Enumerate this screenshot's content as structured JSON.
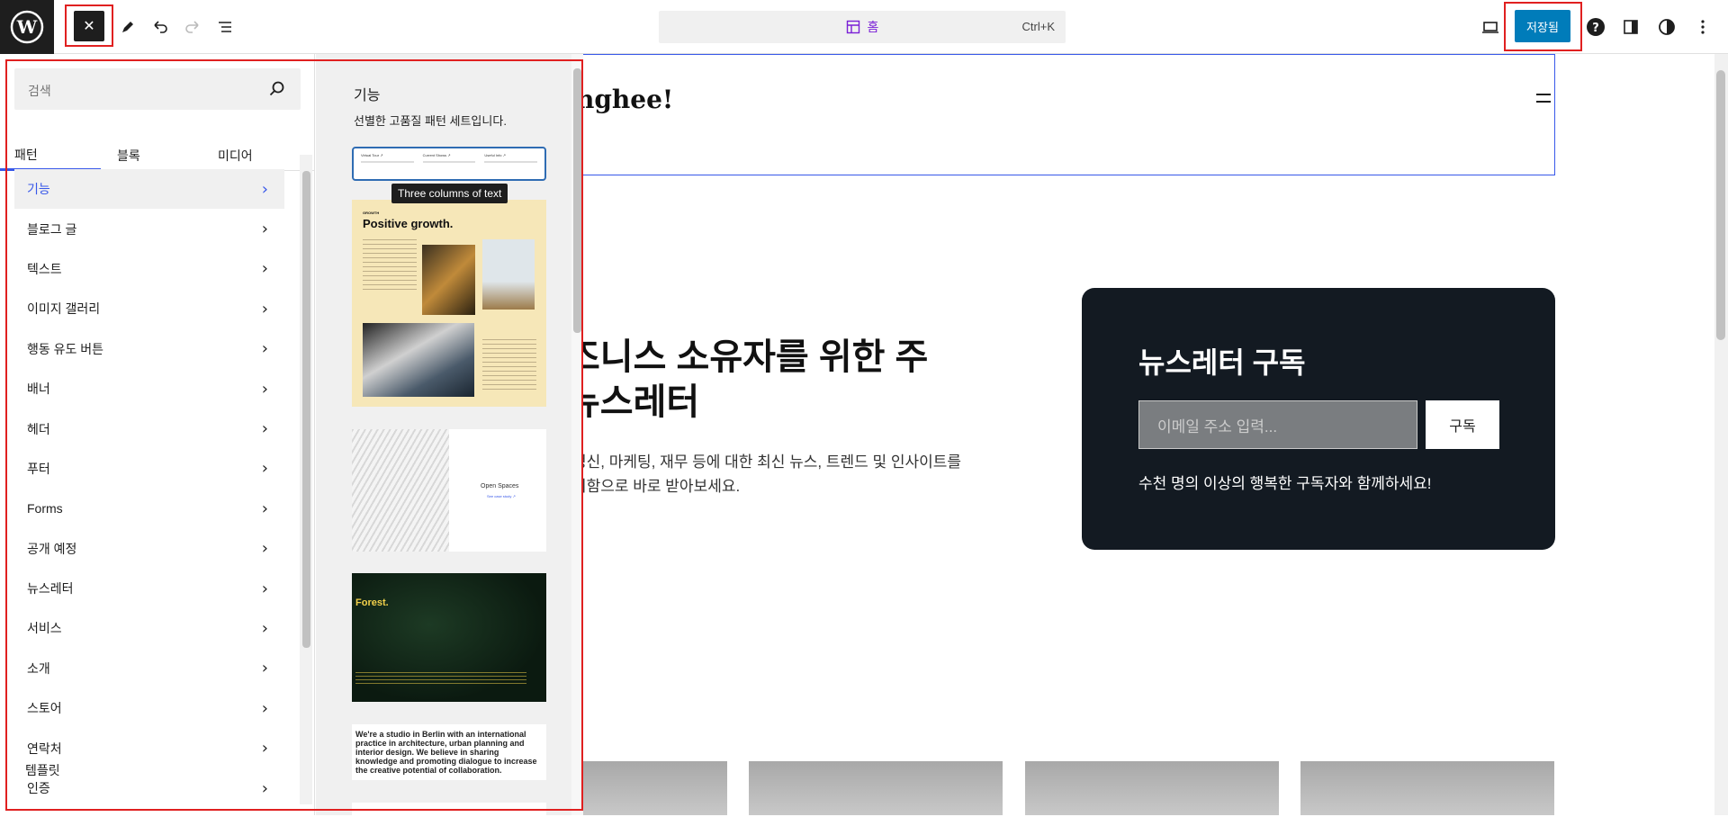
{
  "toolbar": {
    "close_label": "✕",
    "document_title": "홈",
    "shortcut": "Ctrl+K",
    "save_label": "저장됨"
  },
  "site": {
    "title_partial": "nghee!"
  },
  "hero": {
    "heading": "즈니스 소유자를 위한 주\n뉴스레터",
    "text": "정신, 마케팅, 재무 등에 대한 최신 뉴스, 트렌드 및 인사이트를\n지함으로 바로 받아보세요."
  },
  "newsletter": {
    "title": "뉴스레터 구독",
    "placeholder": "이메일 주소 입력...",
    "button": "구독",
    "footnote": "수천 명의 이상의 행복한 구독자와 함께하세요!"
  },
  "inserter": {
    "search_placeholder": "검색",
    "tabs": [
      "패턴",
      "블록",
      "미디어"
    ],
    "categories": [
      "기능",
      "블로그 글",
      "텍스트",
      "이미지 갤러리",
      "행동 유도 버튼",
      "배너",
      "헤더",
      "푸터",
      "Forms",
      "공개 예정",
      "뉴스레터",
      "서비스",
      "소개",
      "스토어",
      "연락처",
      "인증"
    ],
    "templates_label": "템플릿"
  },
  "patterns": {
    "category_title": "기능",
    "category_desc": "선별한 고품질 패턴 세트입니다.",
    "tooltip": "Three columns of text",
    "three_cols": [
      "Virtual Tour ↗",
      "Current Shows ↗",
      "Useful Info ↗"
    ],
    "growth_small": "GROWTH",
    "growth_title": "Positive growth.",
    "open_spaces": "Open Spaces",
    "open_link": "See case study ↗",
    "forest_title": "Forest.",
    "studio_text": "We're a studio in Berlin with an international practice in architecture, urban planning and interior design. We believe in sharing knowledge and promoting dialogue to increase the creative potential of collaboration."
  },
  "colors": {
    "accent": "#3858e9",
    "save_button": "#007cba",
    "newsletter_bg": "#131a22",
    "highlight_boxes": "#e02020"
  }
}
